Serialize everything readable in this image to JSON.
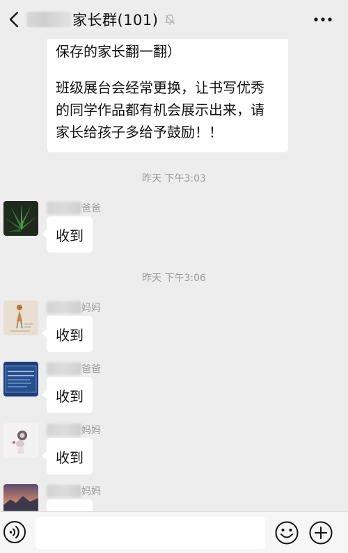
{
  "header": {
    "title": "家长群(101)",
    "back_icon": "chevron-left-icon",
    "mute_icon": "bell-off-icon",
    "more_icon": "more-dots-icon"
  },
  "messages": {
    "first": {
      "line1": "保存的家长翻一翻）",
      "para2": "班级展台会经常更换，让书写优秀\n的同学作品都有机会展示出来，请\n家长给孩子多给予鼓励！！"
    },
    "ts1": "昨天 下午3:03",
    "m1": {
      "sender_suffix": "爸爸",
      "text": "收到"
    },
    "ts2": "昨天 下午3:06",
    "m2": {
      "sender_suffix": "妈妈",
      "text": "收到"
    },
    "m3": {
      "sender_suffix": "爸爸",
      "text": "收到"
    },
    "m4": {
      "sender_suffix": "妈妈",
      "text": "收到"
    },
    "m5": {
      "sender_suffix": "妈妈"
    }
  },
  "bottom": {
    "voice_icon": "voice-icon",
    "emoji_icon": "emoji-icon",
    "plus_icon": "plus-icon"
  }
}
